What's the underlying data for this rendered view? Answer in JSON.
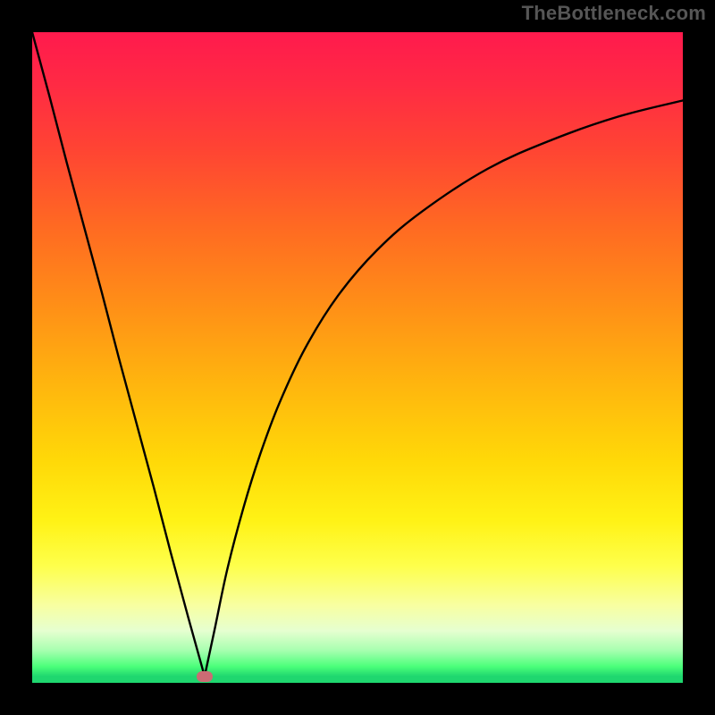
{
  "watermark": "TheBottleneck.com",
  "marker": {
    "x_pct": 26.5,
    "y_pct": 99.0
  },
  "chart_data": {
    "type": "line",
    "title": "",
    "xlabel": "",
    "ylabel": "",
    "xlim": [
      0,
      100
    ],
    "ylim": [
      0,
      100
    ],
    "grid": false,
    "legend": false,
    "background_gradient": [
      "#ff1a4d",
      "#ffd908",
      "#feff4b",
      "#1fd76f"
    ],
    "note": "V-shaped bottleneck curve. Left branch is near-linear descending; right branch is a concave rising curve. Values are visual estimates (percent of plot area).",
    "series": [
      {
        "name": "left-branch",
        "x": [
          0.0,
          2.7,
          5.3,
          8.0,
          10.7,
          13.3,
          16.0,
          18.7,
          21.3,
          24.0,
          26.5
        ],
        "y": [
          100.0,
          90.0,
          80.0,
          70.0,
          60.0,
          50.0,
          40.0,
          30.0,
          20.0,
          10.0,
          1.0
        ]
      },
      {
        "name": "right-branch",
        "x": [
          26.5,
          28.0,
          30.0,
          32.5,
          35.0,
          38.0,
          42.0,
          47.0,
          53.0,
          60.0,
          70.0,
          80.0,
          90.0,
          100.0
        ],
        "y": [
          1.0,
          8.0,
          17.5,
          27.0,
          35.0,
          43.0,
          51.5,
          59.5,
          66.5,
          72.5,
          79.0,
          83.5,
          87.0,
          89.5
        ]
      }
    ],
    "minimum_point": {
      "x": 26.5,
      "y": 1.0
    }
  }
}
